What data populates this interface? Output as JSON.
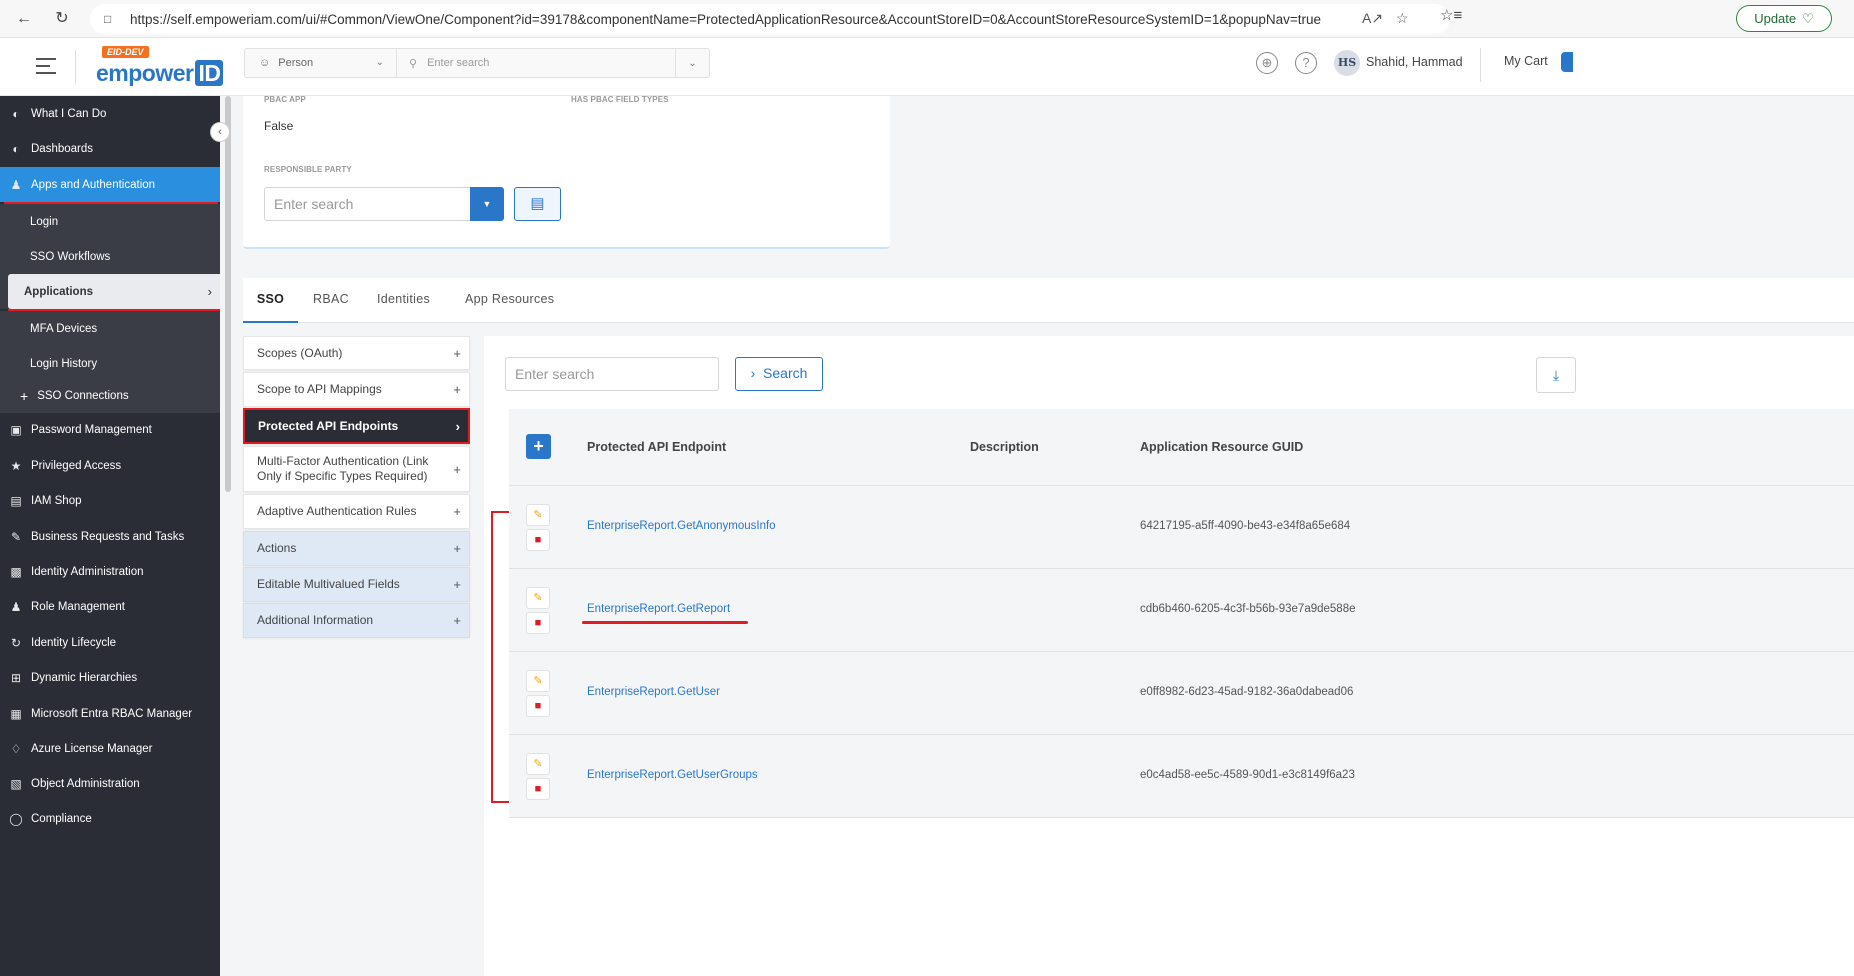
{
  "browser": {
    "url": "https://self.empoweriam.com/ui/#Common/ViewOne/Component?id=39178&componentName=ProtectedApplicationResource&AccountStoreID=0&AccountStoreResourceSystemID=1&popupNav=true",
    "update_label": "Update"
  },
  "header": {
    "logo_badge": "EID-DEV",
    "logo_word": "empower",
    "logo_id": "ID",
    "search_type": "Person",
    "search_placeholder": "Enter search",
    "user_initials": "HS",
    "user_name": "Shahid, Hammad",
    "cart_label": "My Cart"
  },
  "sidebar": {
    "items": [
      {
        "label": "What I Can Do",
        "icon": "gauge-icon"
      },
      {
        "label": "Dashboards",
        "icon": "gauge-icon"
      },
      {
        "label": "Apps and Authentication",
        "icon": "user-key-icon"
      },
      {
        "label": "Login"
      },
      {
        "label": "SSO Workflows"
      },
      {
        "label": "Applications"
      },
      {
        "label": "MFA Devices"
      },
      {
        "label": "Login History"
      },
      {
        "label": "SSO Connections"
      },
      {
        "label": "Password Management",
        "icon": "password-icon"
      },
      {
        "label": "Privileged Access",
        "icon": "star-icon"
      },
      {
        "label": "IAM Shop",
        "icon": "cart-icon"
      },
      {
        "label": "Business Requests and Tasks",
        "icon": "edit-icon"
      },
      {
        "label": "Identity Administration",
        "icon": "id-card-icon"
      },
      {
        "label": "Role Management",
        "icon": "role-icon"
      },
      {
        "label": "Identity Lifecycle",
        "icon": "lifecycle-icon"
      },
      {
        "label": "Dynamic Hierarchies",
        "icon": "hierarchy-icon"
      },
      {
        "label": "Microsoft Entra RBAC Manager",
        "icon": "cube-icon"
      },
      {
        "label": "Azure License Manager",
        "icon": "license-icon"
      },
      {
        "label": "Object Administration",
        "icon": "object-icon"
      },
      {
        "label": "Compliance",
        "icon": "compliance-icon"
      }
    ]
  },
  "details": {
    "pbac_app_label": "PBAC APP",
    "pbac_app_value": "False",
    "has_pbac_label": "HAS PBAC FIELD TYPES",
    "responsible_party_label": "RESPONSIBLE PARTY",
    "responsible_party_placeholder": "Enter search"
  },
  "tabs": [
    "SSO",
    "RBAC",
    "Identities",
    "App Resources"
  ],
  "accordion": [
    "Scopes (OAuth)",
    "Scope to API Mappings",
    "Protected API Endpoints",
    "Multi-Factor Authentication (Link Only if Specific Types Required)",
    "Adaptive Authentication Rules",
    "Actions",
    "Editable Multivalued Fields",
    "Additional Information"
  ],
  "grid": {
    "search_placeholder": "Enter search",
    "search_label": "Search",
    "columns": [
      "Protected API Endpoint",
      "Description",
      "Application Resource GUID"
    ],
    "rows": [
      {
        "endpoint": "EnterpriseReport.GetAnonymousInfo",
        "description": "",
        "guid": "64217195-a5ff-4090-be43-e34f8a65e684"
      },
      {
        "endpoint": "EnterpriseReport.GetReport",
        "description": "",
        "guid": "cdb6b460-6205-4c3f-b56b-93e7a9de588e"
      },
      {
        "endpoint": "EnterpriseReport.GetUser",
        "description": "",
        "guid": "e0ff8982-6d23-45ad-9182-36a0dabead06"
      },
      {
        "endpoint": "EnterpriseReport.GetUserGroups",
        "description": "",
        "guid": "e0c4ad58-ee5c-4589-90d1-e3c8149f6a23"
      }
    ]
  },
  "colors": {
    "accent": "#2a77c9",
    "sidebar": "#2a2d36",
    "highlight": "#e01b24"
  }
}
